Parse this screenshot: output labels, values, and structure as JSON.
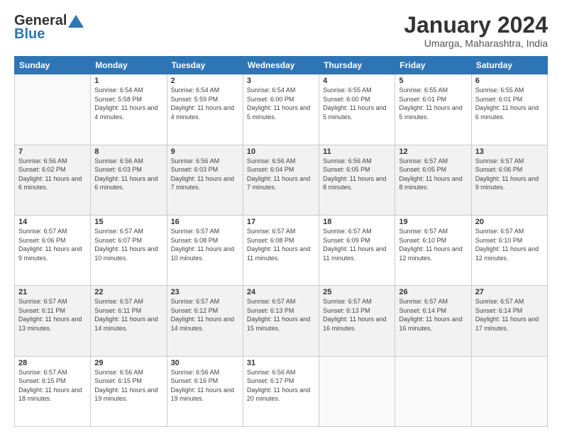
{
  "header": {
    "logo": {
      "line1": "General",
      "line2": "Blue"
    },
    "title": "January 2024",
    "subtitle": "Umarga, Maharashtra, India"
  },
  "days": [
    "Sunday",
    "Monday",
    "Tuesday",
    "Wednesday",
    "Thursday",
    "Friday",
    "Saturday"
  ],
  "weeks": [
    [
      {
        "num": "",
        "sunrise": "",
        "sunset": "",
        "daylight": ""
      },
      {
        "num": "1",
        "sunrise": "Sunrise: 6:54 AM",
        "sunset": "Sunset: 5:58 PM",
        "daylight": "Daylight: 11 hours and 4 minutes."
      },
      {
        "num": "2",
        "sunrise": "Sunrise: 6:54 AM",
        "sunset": "Sunset: 5:59 PM",
        "daylight": "Daylight: 11 hours and 4 minutes."
      },
      {
        "num": "3",
        "sunrise": "Sunrise: 6:54 AM",
        "sunset": "Sunset: 6:00 PM",
        "daylight": "Daylight: 11 hours and 5 minutes."
      },
      {
        "num": "4",
        "sunrise": "Sunrise: 6:55 AM",
        "sunset": "Sunset: 6:00 PM",
        "daylight": "Daylight: 11 hours and 5 minutes."
      },
      {
        "num": "5",
        "sunrise": "Sunrise: 6:55 AM",
        "sunset": "Sunset: 6:01 PM",
        "daylight": "Daylight: 11 hours and 5 minutes."
      },
      {
        "num": "6",
        "sunrise": "Sunrise: 6:55 AM",
        "sunset": "Sunset: 6:01 PM",
        "daylight": "Daylight: 11 hours and 6 minutes."
      }
    ],
    [
      {
        "num": "7",
        "sunrise": "Sunrise: 6:56 AM",
        "sunset": "Sunset: 6:02 PM",
        "daylight": "Daylight: 11 hours and 6 minutes."
      },
      {
        "num": "8",
        "sunrise": "Sunrise: 6:56 AM",
        "sunset": "Sunset: 6:03 PM",
        "daylight": "Daylight: 11 hours and 6 minutes."
      },
      {
        "num": "9",
        "sunrise": "Sunrise: 6:56 AM",
        "sunset": "Sunset: 6:03 PM",
        "daylight": "Daylight: 11 hours and 7 minutes."
      },
      {
        "num": "10",
        "sunrise": "Sunrise: 6:56 AM",
        "sunset": "Sunset: 6:04 PM",
        "daylight": "Daylight: 11 hours and 7 minutes."
      },
      {
        "num": "11",
        "sunrise": "Sunrise: 6:56 AM",
        "sunset": "Sunset: 6:05 PM",
        "daylight": "Daylight: 11 hours and 8 minutes."
      },
      {
        "num": "12",
        "sunrise": "Sunrise: 6:57 AM",
        "sunset": "Sunset: 6:05 PM",
        "daylight": "Daylight: 11 hours and 8 minutes."
      },
      {
        "num": "13",
        "sunrise": "Sunrise: 6:57 AM",
        "sunset": "Sunset: 6:06 PM",
        "daylight": "Daylight: 11 hours and 9 minutes."
      }
    ],
    [
      {
        "num": "14",
        "sunrise": "Sunrise: 6:57 AM",
        "sunset": "Sunset: 6:06 PM",
        "daylight": "Daylight: 11 hours and 9 minutes."
      },
      {
        "num": "15",
        "sunrise": "Sunrise: 6:57 AM",
        "sunset": "Sunset: 6:07 PM",
        "daylight": "Daylight: 11 hours and 10 minutes."
      },
      {
        "num": "16",
        "sunrise": "Sunrise: 6:57 AM",
        "sunset": "Sunset: 6:08 PM",
        "daylight": "Daylight: 11 hours and 10 minutes."
      },
      {
        "num": "17",
        "sunrise": "Sunrise: 6:57 AM",
        "sunset": "Sunset: 6:08 PM",
        "daylight": "Daylight: 11 hours and 11 minutes."
      },
      {
        "num": "18",
        "sunrise": "Sunrise: 6:57 AM",
        "sunset": "Sunset: 6:09 PM",
        "daylight": "Daylight: 11 hours and 11 minutes."
      },
      {
        "num": "19",
        "sunrise": "Sunrise: 6:57 AM",
        "sunset": "Sunset: 6:10 PM",
        "daylight": "Daylight: 11 hours and 12 minutes."
      },
      {
        "num": "20",
        "sunrise": "Sunrise: 6:57 AM",
        "sunset": "Sunset: 6:10 PM",
        "daylight": "Daylight: 11 hours and 12 minutes."
      }
    ],
    [
      {
        "num": "21",
        "sunrise": "Sunrise: 6:57 AM",
        "sunset": "Sunset: 6:11 PM",
        "daylight": "Daylight: 11 hours and 13 minutes."
      },
      {
        "num": "22",
        "sunrise": "Sunrise: 6:57 AM",
        "sunset": "Sunset: 6:11 PM",
        "daylight": "Daylight: 11 hours and 14 minutes."
      },
      {
        "num": "23",
        "sunrise": "Sunrise: 6:57 AM",
        "sunset": "Sunset: 6:12 PM",
        "daylight": "Daylight: 11 hours and 14 minutes."
      },
      {
        "num": "24",
        "sunrise": "Sunrise: 6:57 AM",
        "sunset": "Sunset: 6:13 PM",
        "daylight": "Daylight: 11 hours and 15 minutes."
      },
      {
        "num": "25",
        "sunrise": "Sunrise: 6:57 AM",
        "sunset": "Sunset: 6:13 PM",
        "daylight": "Daylight: 11 hours and 16 minutes."
      },
      {
        "num": "26",
        "sunrise": "Sunrise: 6:57 AM",
        "sunset": "Sunset: 6:14 PM",
        "daylight": "Daylight: 11 hours and 16 minutes."
      },
      {
        "num": "27",
        "sunrise": "Sunrise: 6:57 AM",
        "sunset": "Sunset: 6:14 PM",
        "daylight": "Daylight: 11 hours and 17 minutes."
      }
    ],
    [
      {
        "num": "28",
        "sunrise": "Sunrise: 6:57 AM",
        "sunset": "Sunset: 6:15 PM",
        "daylight": "Daylight: 11 hours and 18 minutes."
      },
      {
        "num": "29",
        "sunrise": "Sunrise: 6:56 AM",
        "sunset": "Sunset: 6:15 PM",
        "daylight": "Daylight: 11 hours and 19 minutes."
      },
      {
        "num": "30",
        "sunrise": "Sunrise: 6:56 AM",
        "sunset": "Sunset: 6:16 PM",
        "daylight": "Daylight: 11 hours and 19 minutes."
      },
      {
        "num": "31",
        "sunrise": "Sunrise: 6:56 AM",
        "sunset": "Sunset: 6:17 PM",
        "daylight": "Daylight: 11 hours and 20 minutes."
      },
      {
        "num": "",
        "sunrise": "",
        "sunset": "",
        "daylight": ""
      },
      {
        "num": "",
        "sunrise": "",
        "sunset": "",
        "daylight": ""
      },
      {
        "num": "",
        "sunrise": "",
        "sunset": "",
        "daylight": ""
      }
    ]
  ]
}
